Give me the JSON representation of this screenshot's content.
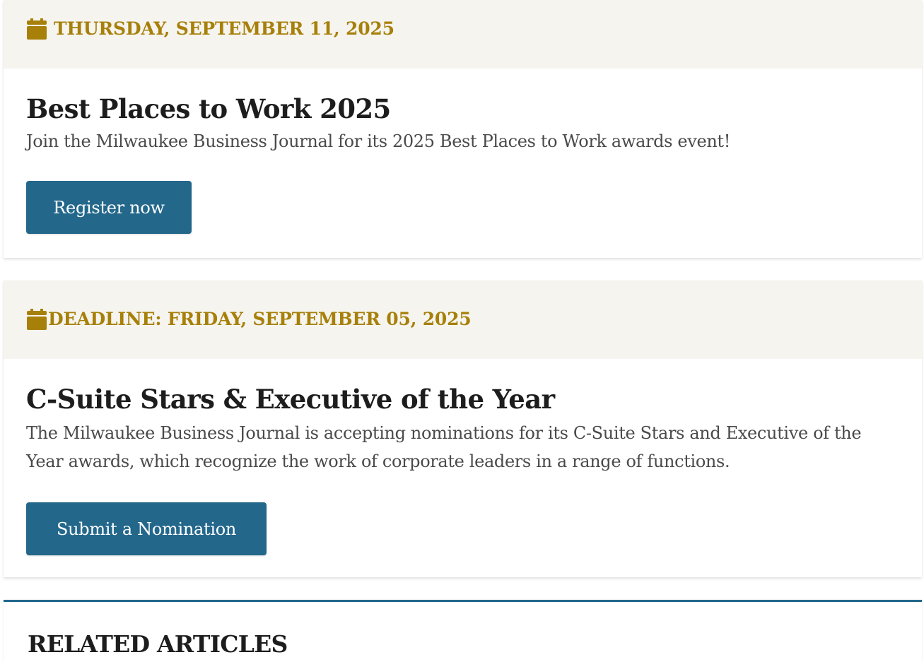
{
  "events": [
    {
      "date_icon": "calendar-icon",
      "date_label": "THURSDAY, SEPTEMBER 11, 2025",
      "title": "Best Places to Work 2025",
      "description": "Join the Milwaukee Business Journal for its 2025 Best Places to Work awards event!",
      "button_label": "Register now"
    },
    {
      "date_icon": "calendar-icon",
      "date_label": "DEADLINE: FRIDAY, SEPTEMBER 05, 2025",
      "title": "C-Suite Stars & Executive of the Year",
      "description": "The Milwaukee Business Journal is accepting nominations for its C-Suite Stars and Executive of the Year awards, which recognize the work of corporate leaders in a range of functions.",
      "button_label": "Submit a Nomination"
    }
  ],
  "related": {
    "heading": "RELATED ARTICLES"
  },
  "colors": {
    "accent_gold": "#a7800a",
    "button_blue": "#23678b",
    "header_bg": "#f6f4ef",
    "text_dark": "#1d1d1d",
    "text_body": "#4a4a4a"
  }
}
